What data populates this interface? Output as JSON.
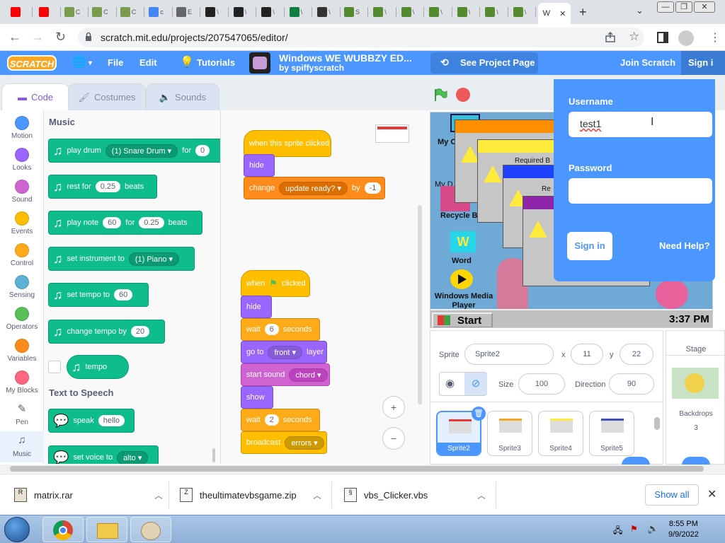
{
  "browser": {
    "tab_icon_colors": [
      "#ff0000",
      "#ff0000",
      "#7a9c4f",
      "#7a9c4f",
      "#7a9c4f",
      "#4285f4",
      "#666666",
      "#222222",
      "#222222",
      "#222222",
      "#0b8043",
      "#333333",
      "#558b2f",
      "#558b2f",
      "#558b2f",
      "#558b2f",
      "#558b2f",
      "#558b2f",
      "#558b2f"
    ],
    "tab_letters": [
      "",
      "",
      "C",
      "C",
      "C",
      "c",
      "E",
      "\\",
      "\\",
      "\\",
      "\\",
      "\\",
      "S",
      "\\",
      "\\",
      "\\",
      "\\",
      "\\",
      "\\"
    ],
    "active_tab_label": "W",
    "active_tab_close": "✕",
    "new_tab": "+",
    "tabs_dropdown": "⌄",
    "window_controls": [
      "—",
      "❐",
      "✕"
    ],
    "nav_back": "←",
    "nav_forward": "→",
    "nav_reload": "↻",
    "url": "scratch.mit.edu/projects/207547065/editor/",
    "toolbar_icons": [
      "share-icon",
      "star-icon",
      "sidebar-icon",
      "profile-icon",
      "menu-icon"
    ]
  },
  "scratch": {
    "logo": "SCRATCH",
    "menu": {
      "globe": "🌐",
      "file": "File",
      "edit": "Edit",
      "tutorials": "Tutorials",
      "project_title": "Windows WE WUBBZY ED...",
      "project_author": "by spiffyscratch",
      "see_project_page": "See Project Page",
      "join": "Join Scratch",
      "sign_in": "Sign i"
    },
    "editor_tabs": [
      "Code",
      "Costumes",
      "Sounds"
    ],
    "categories": [
      {
        "label": "Motion",
        "color": "#4c97ff"
      },
      {
        "label": "Looks",
        "color": "#9966ff"
      },
      {
        "label": "Sound",
        "color": "#cf63cf"
      },
      {
        "label": "Events",
        "color": "#ffbf00"
      },
      {
        "label": "Control",
        "color": "#ffab19"
      },
      {
        "label": "Sensing",
        "color": "#5cb1d6"
      },
      {
        "label": "Operators",
        "color": "#59c059"
      },
      {
        "label": "Variables",
        "color": "#ff8c1a"
      },
      {
        "label": "My Blocks",
        "color": "#ff6680"
      },
      {
        "label": "Pen",
        "color": "#0fbd8c"
      },
      {
        "label": "Music",
        "color": "#0fbd8c"
      }
    ],
    "palette": {
      "music_heading": "Music",
      "play_drum": "play drum",
      "drum_value": "(1) Snare Drum ▾",
      "for": "for",
      "for_value": "0",
      "rest_for": "rest for",
      "rest_value": "0.25",
      "beats": "beats",
      "play_note": "play note",
      "note_value": "60",
      "note_for": "for",
      "note_beats": "0.25",
      "note_beats_label": "beats",
      "set_instrument": "set instrument to",
      "instrument_value": "(1) Piano ▾",
      "set_tempo": "set tempo to",
      "tempo_value": "60",
      "change_tempo": "change tempo by",
      "change_tempo_value": "20",
      "tempo_reporter": "tempo",
      "tts_heading": "Text to Speech",
      "speak": "speak",
      "speak_value": "hello",
      "set_voice": "set voice to",
      "voice_value": "alto ▾"
    },
    "script1": {
      "hat": "when this sprite clicked",
      "hide": "hide",
      "change": "change",
      "var": "update ready? ▾",
      "by": "by",
      "by_value": "-1"
    },
    "script2": {
      "when": "when",
      "clicked": "clicked",
      "hide": "hide",
      "wait1": "wait",
      "wait1_value": "6",
      "seconds1": "seconds",
      "goto": "go to",
      "layer_value": "front ▾",
      "layer": "layer",
      "start_sound": "start sound",
      "sound_value": "chord ▾",
      "show": "show",
      "wait2": "wait",
      "wait2_value": "2",
      "seconds2": "seconds",
      "broadcast": "broadcast",
      "broadcast_value": "errors ▾"
    },
    "zoom": {
      "in": "+",
      "out": "−",
      "reset": "="
    },
    "stage": {
      "labels": [
        "My C",
        "My D",
        "Recycle B",
        "Word",
        "Windows Media Player",
        "Required B",
        "Re"
      ],
      "start": "Start",
      "time": "3:37 PM"
    },
    "login": {
      "username_label": "Username",
      "username_value": "test1",
      "password_label": "Password",
      "password_value": "",
      "sign_in_button": "Sign in",
      "need_help": "Need Help?"
    },
    "sprite_info": {
      "sprite_label": "Sprite",
      "sprite_name": "Sprite2",
      "x_label": "x",
      "x_value": "11",
      "y_label": "y",
      "y_value": "22",
      "size_label": "Size",
      "size_value": "100",
      "direction_label": "Direction",
      "direction_value": "90",
      "sprites": [
        "Sprite2",
        "Sprite3",
        "Sprite4",
        "Sprite5"
      ],
      "sprite_bar_colors": [
        "#e53935",
        "#f5a623",
        "#ffeb3b",
        "#3f51b5"
      ]
    },
    "stage_pane": {
      "label": "Stage",
      "backdrops_label": "Backdrops",
      "backdrops_count": "3"
    }
  },
  "downloads": [
    {
      "name": "matrix.rar"
    },
    {
      "name": "theultimatevbsgame.zip"
    },
    {
      "name": "vbs_Clicker.vbs"
    }
  ],
  "downloads_show_all": "Show all",
  "downloads_close": "✕",
  "taskbar": {
    "time": "8:55 PM",
    "date": "9/9/2022"
  }
}
